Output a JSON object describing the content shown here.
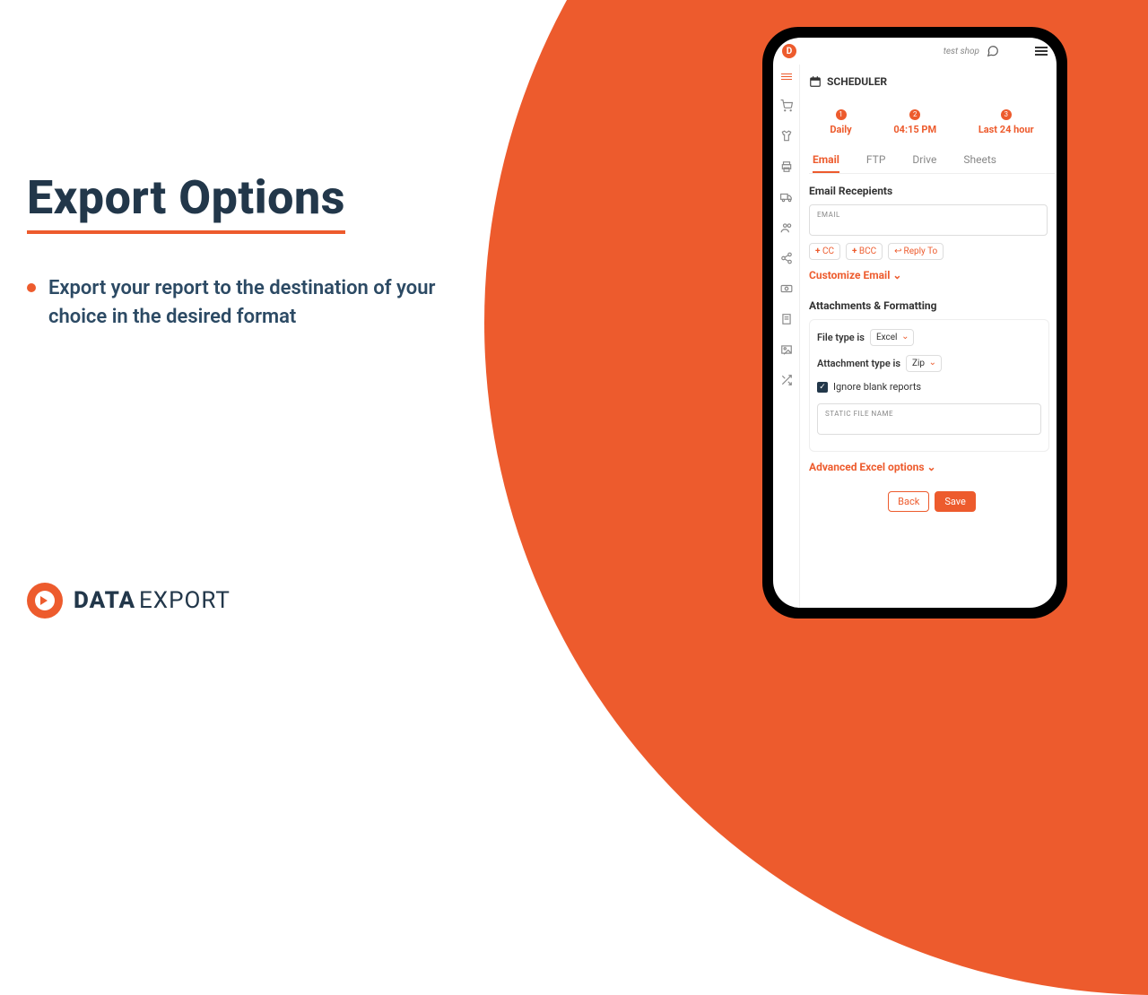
{
  "page": {
    "headline": "Export  Options",
    "bullet": "Export your report to the destination of your choice in the desired format"
  },
  "logo": {
    "word1": "DATA",
    "word2": "EXPORT"
  },
  "app": {
    "shop_label": "test shop",
    "section_title": "SCHEDULER",
    "steps": [
      {
        "num": "1",
        "label": "Daily"
      },
      {
        "num": "2",
        "label": "04:15 PM"
      },
      {
        "num": "3",
        "label": "Last 24 hour"
      }
    ],
    "tabs": [
      "Email",
      "FTP",
      "Drive",
      "Sheets"
    ],
    "email": {
      "recipients_heading": "Email Recepients",
      "email_label": "EMAIL",
      "cc": "CC",
      "bcc": "BCC",
      "reply": "Reply To",
      "customize": "Customize Email"
    },
    "attach": {
      "heading": "Attachments & Formatting",
      "file_type_label": "File type is",
      "file_type_value": "Excel",
      "attach_type_label": "Attachment type is",
      "attach_type_value": "Zip",
      "ignore": "Ignore blank reports",
      "static_label": "STATIC FILE NAME",
      "advanced": "Advanced Excel options"
    },
    "actions": {
      "back": "Back",
      "save": "Save"
    }
  }
}
